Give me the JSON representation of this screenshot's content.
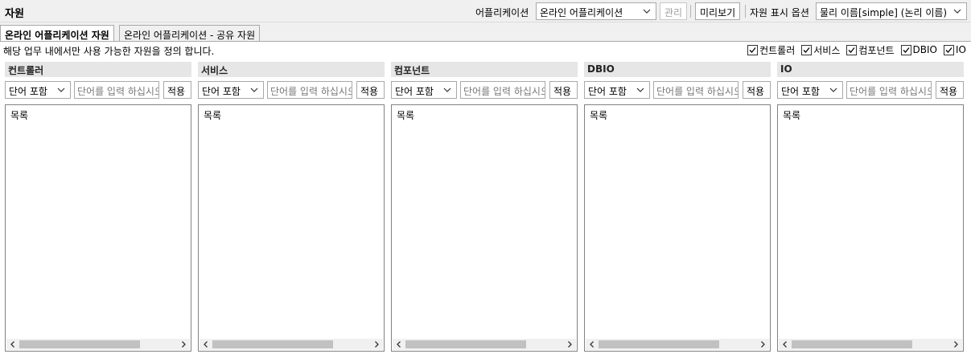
{
  "header": {
    "title": "자원",
    "app_label": "어플리케이션",
    "app_select": "온라인 어플리케이션",
    "manage_button": "관리",
    "preview_button": "미리보기",
    "display_option_label": "자원 표시 옵션",
    "display_option_select": "물리 이름[simple] (논리 이름)"
  },
  "tabs": [
    {
      "label": "온라인 어플리케이션 자원",
      "active": true
    },
    {
      "label": "온라인 어플리케이션 - 공유 자원",
      "active": false
    }
  ],
  "description": "해당 업무 내에서만 사용 가능한 자원을 정의 합니다.",
  "filters": [
    {
      "label": "컨트롤러",
      "checked": true
    },
    {
      "label": "서비스",
      "checked": true
    },
    {
      "label": "컴포넌트",
      "checked": true
    },
    {
      "label": "DBIO",
      "checked": true
    },
    {
      "label": "IO",
      "checked": true
    }
  ],
  "panels": [
    {
      "title": "컨트롤러",
      "match_select": "단어 포함",
      "input_placeholder": "단어를 입력 하십시오",
      "apply": "적용",
      "list_label": "목록"
    },
    {
      "title": "서비스",
      "match_select": "단어 포함",
      "input_placeholder": "단어를 입력 하십시오",
      "apply": "적용",
      "list_label": "목록"
    },
    {
      "title": "컴포넌트",
      "match_select": "단어 포함",
      "input_placeholder": "단어를 입력 하십시오",
      "apply": "적용",
      "list_label": "목록"
    },
    {
      "title": "DBIO",
      "match_select": "단어 포함",
      "input_placeholder": "단어를 입력 하십시오",
      "apply": "적용",
      "list_label": "목록"
    },
    {
      "title": "IO",
      "match_select": "단어 포함",
      "input_placeholder": "단어를 입력 하십시오",
      "apply": "적용",
      "list_label": "목록"
    }
  ]
}
